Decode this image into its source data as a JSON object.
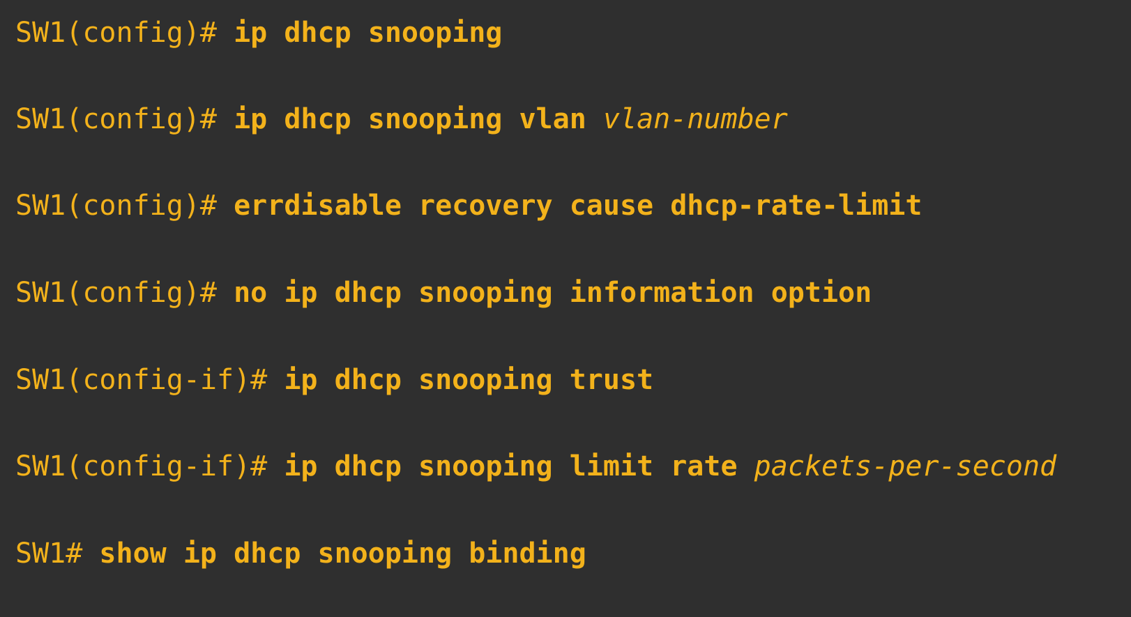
{
  "theme": {
    "background": "#2f2f2f",
    "text_color": "#f3b21b"
  },
  "lines": [
    {
      "prompt": "SW1(config)#",
      "command": "ip dhcp snooping",
      "argument": ""
    },
    {
      "prompt": "SW1(config)#",
      "command": "ip dhcp snooping vlan",
      "argument": "vlan-number"
    },
    {
      "prompt": "SW1(config)#",
      "command": "errdisable recovery cause dhcp-rate-limit",
      "argument": ""
    },
    {
      "prompt": "SW1(config)#",
      "command": "no ip dhcp snooping information option",
      "argument": ""
    },
    {
      "prompt": "SW1(config-if)#",
      "command": "ip dhcp snooping trust",
      "argument": ""
    },
    {
      "prompt": "SW1(config-if)#",
      "command": "ip dhcp snooping limit rate",
      "argument": "packets-per-second"
    },
    {
      "prompt": "SW1#",
      "command": "show ip dhcp snooping binding",
      "argument": ""
    }
  ]
}
